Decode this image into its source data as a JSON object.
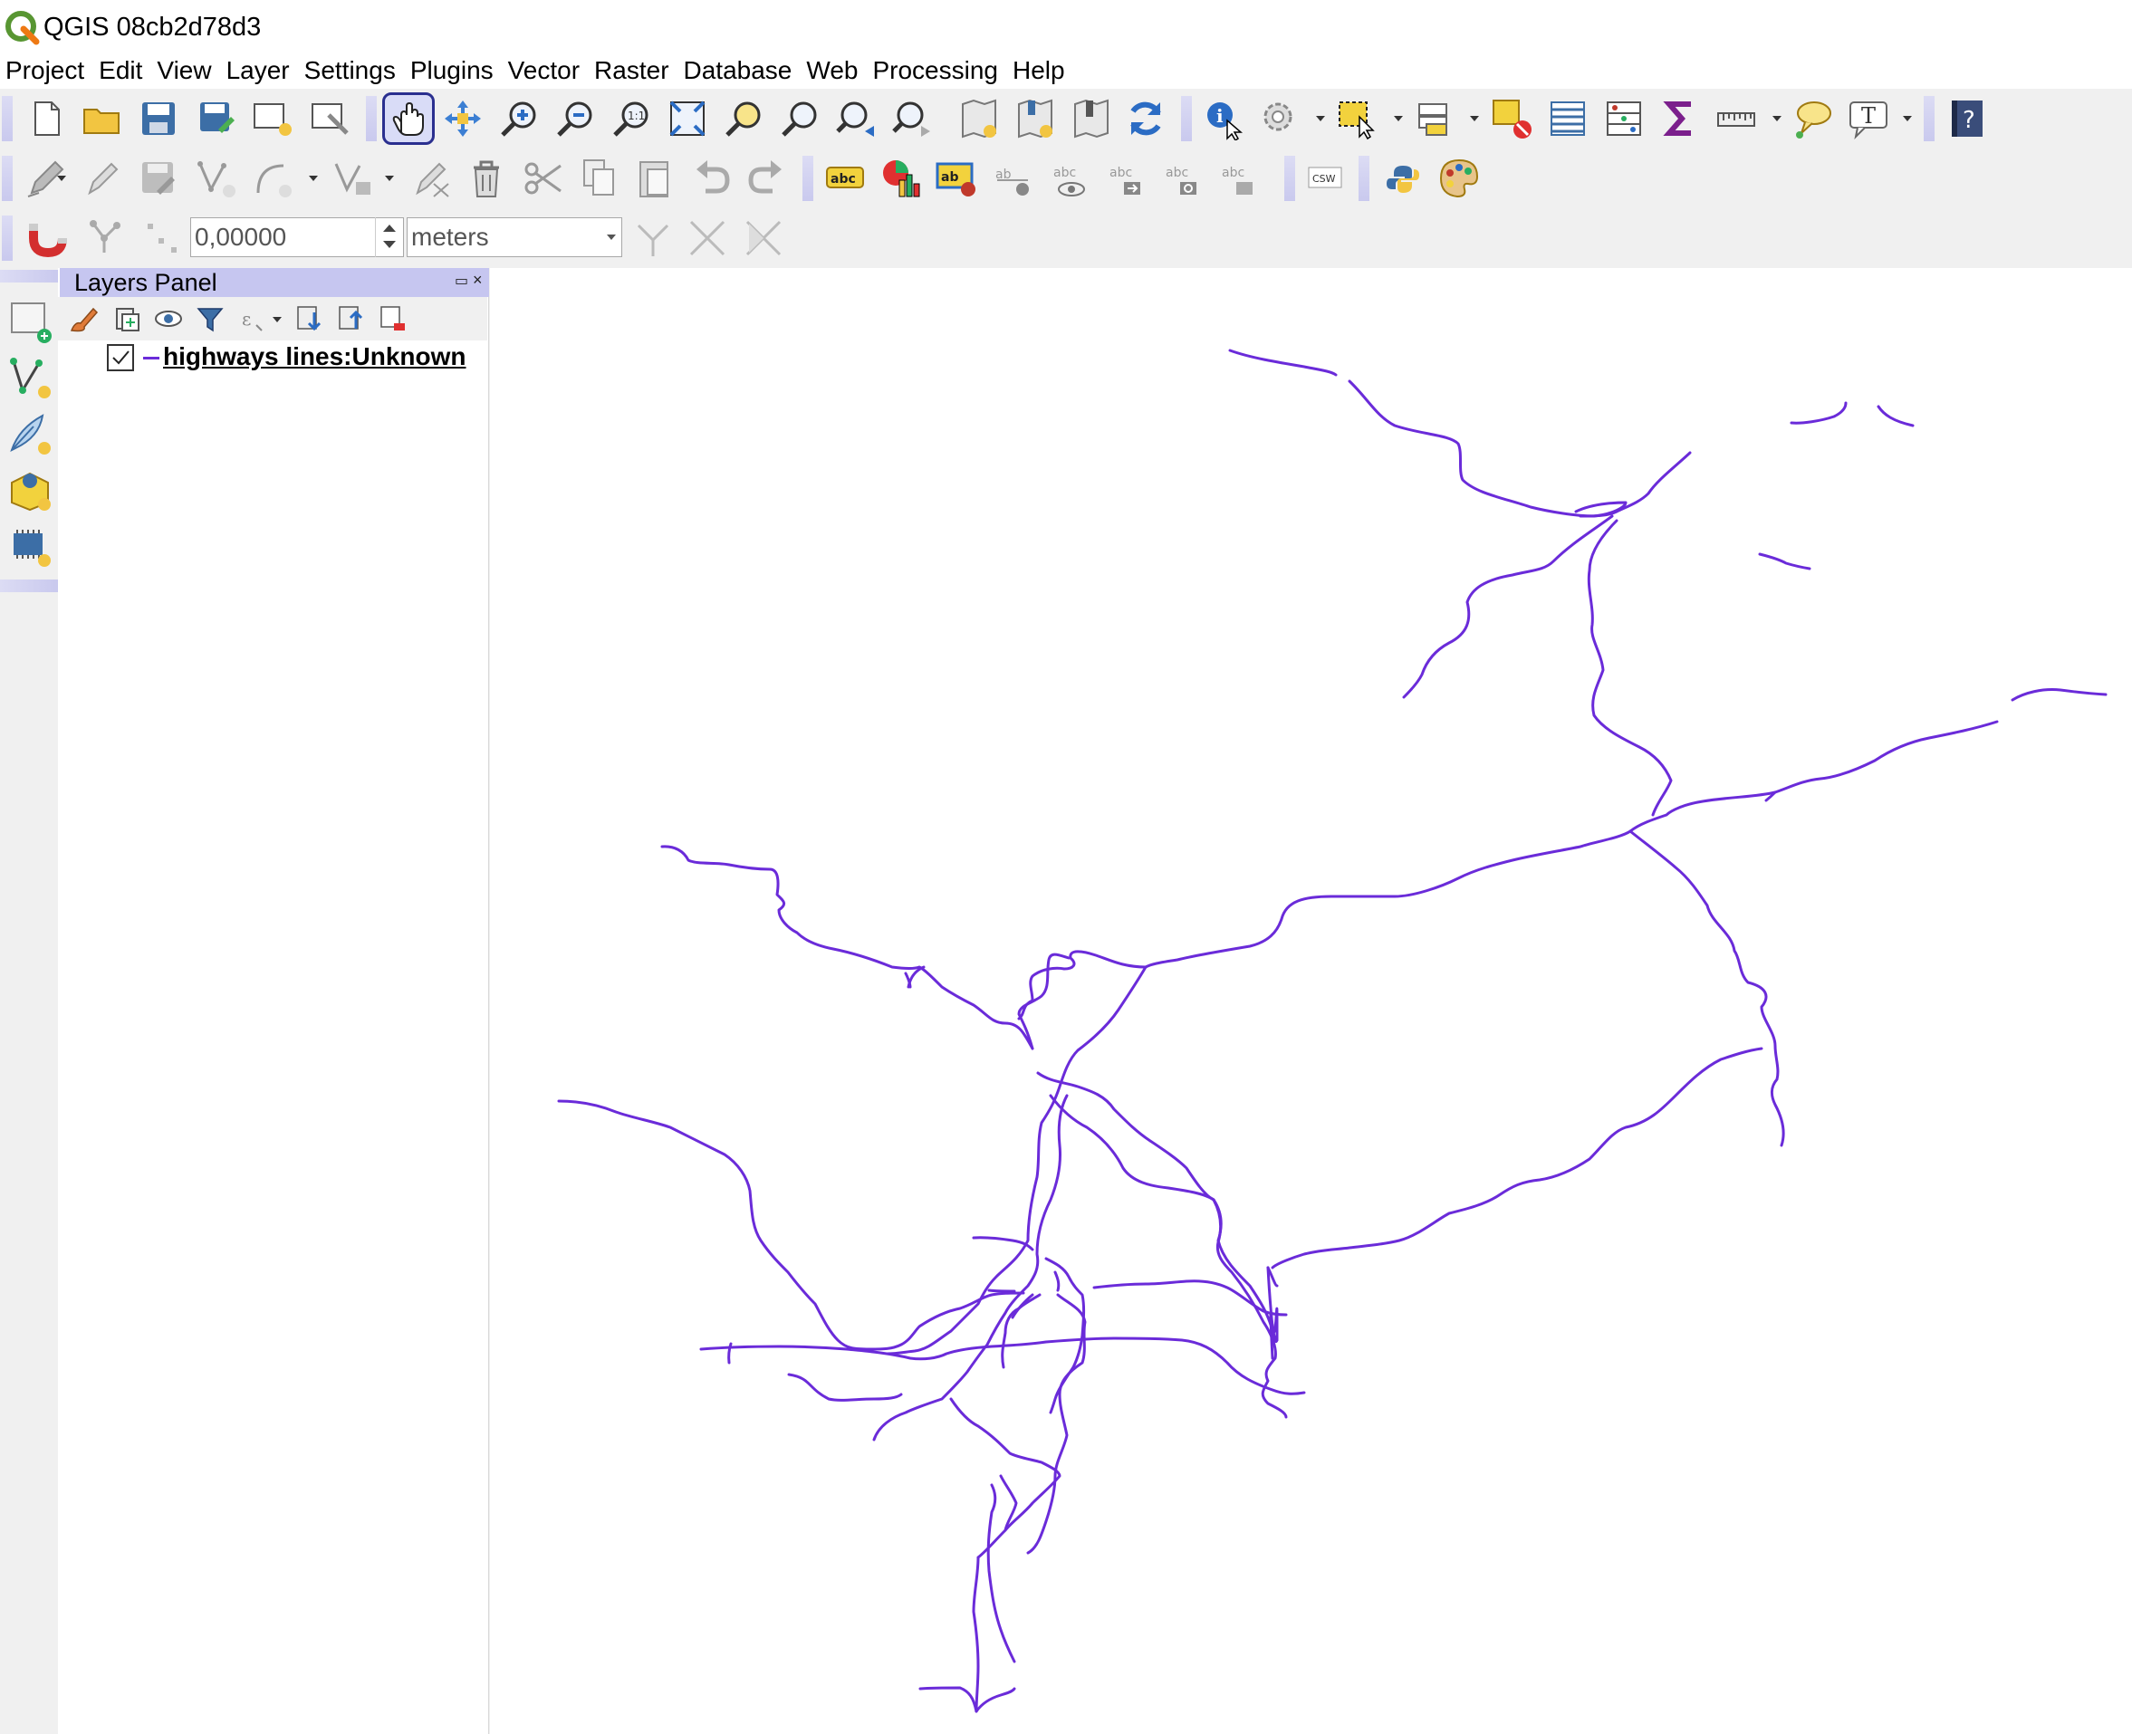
{
  "window": {
    "title": "QGIS 08cb2d78d3"
  },
  "menubar": {
    "items": [
      "Project",
      "Edit",
      "View",
      "Layer",
      "Settings",
      "Plugins",
      "Vector",
      "Raster",
      "Database",
      "Web",
      "Processing",
      "Help"
    ]
  },
  "toolbars": {
    "snapping": {
      "tolerance_value": "0,00000",
      "unit": "meters"
    },
    "icons": {
      "row1": [
        "new-project-icon",
        "open-project-icon",
        "save-project-icon",
        "save-as-icon",
        "new-print-layout-icon",
        "style-manager-icon",
        "pan-icon",
        "pan-to-selection-icon",
        "zoom-in-icon",
        "zoom-out-icon",
        "zoom-native-icon",
        "zoom-full-icon",
        "zoom-to-selection-icon",
        "zoom-to-layer-icon",
        "zoom-last-icon",
        "zoom-next-icon",
        "new-bookmark-icon",
        "show-bookmarks-icon",
        "temporal-icon",
        "refresh-icon",
        "identify-icon",
        "run-action-icon",
        "select-features-icon",
        "open-field-calculator-icon",
        "deselect-icon",
        "attribute-table-icon",
        "statistics-icon",
        "sum-icon",
        "measure-icon",
        "map-tips-icon",
        "text-annotation-icon",
        "help-icon"
      ],
      "row2": [
        "current-edits-icon",
        "toggle-editing-icon",
        "save-edits-icon",
        "add-feature-icon",
        "add-circular-string-icon",
        "vertex-tool-icon",
        "digitize-with-segment-icon",
        "delete-selected-icon",
        "cut-features-icon",
        "copy-features-icon",
        "paste-features-icon",
        "undo-icon",
        "redo-icon",
        "layer-labeling-icon",
        "diagram-icon",
        "highlight-pinned-labels-icon",
        "pin-labels-icon",
        "show-hide-labels-icon",
        "move-label-icon",
        "rotate-label-icon",
        "change-label-icon",
        "csw-icon",
        "python-console-icon",
        "style-icon"
      ],
      "row3": [
        "snapping-magnet-icon",
        "snapping-mode-icon",
        "snapping-type-icon",
        "tracing-icon",
        "intersection-icon",
        "self-snapping-icon"
      ]
    }
  },
  "layers_panel": {
    "title": "Layers Panel",
    "layers": [
      {
        "name": "highways lines:Unknown",
        "visible": true,
        "symbol_color": "#6a2bd9"
      }
    ]
  },
  "map": {
    "road_color": "#6a2bd9",
    "background": "#ffffff"
  }
}
